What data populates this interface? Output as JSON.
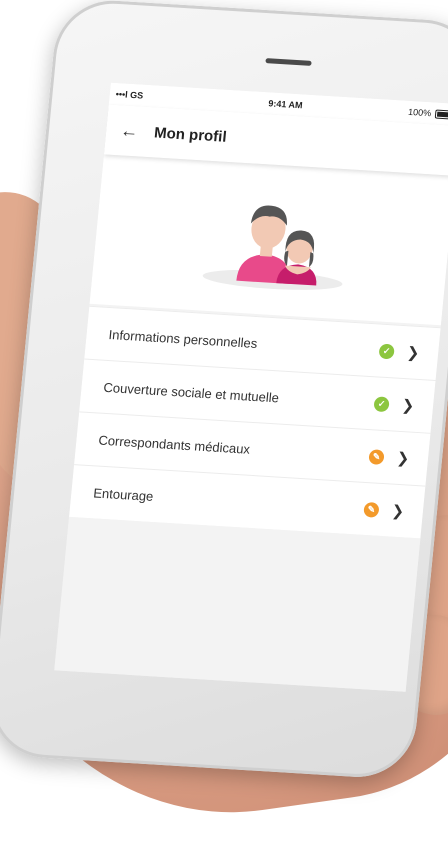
{
  "status_bar": {
    "carrier": "•••l GS",
    "time": "9:41 AM",
    "battery": "100%"
  },
  "header": {
    "title": "Mon profil"
  },
  "profile_items": [
    {
      "label": "Informations personnelles",
      "status": "check-icon"
    },
    {
      "label": "Couverture sociale et mutuelle",
      "status": "check-icon"
    },
    {
      "label": "Correspondants médicaux",
      "status": "pencil-icon"
    },
    {
      "label": "Entourage",
      "status": "pencil-icon"
    }
  ],
  "colors": {
    "check": "#8cc63f",
    "pencil": "#f39a2b",
    "avatar_pink": "#e84a8a"
  }
}
